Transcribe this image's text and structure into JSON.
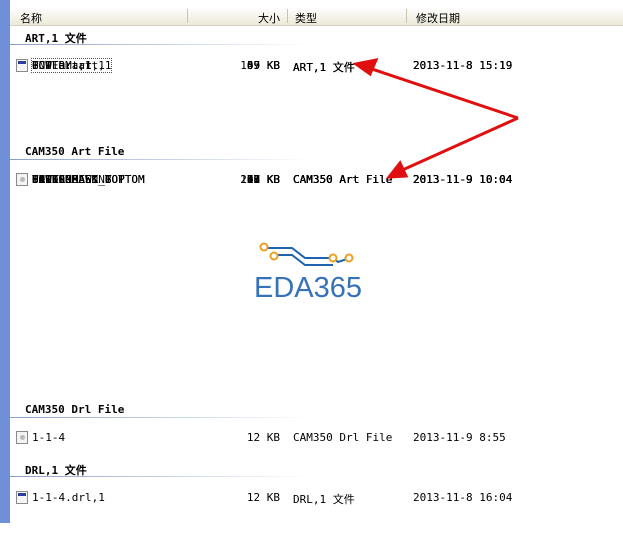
{
  "header": {
    "name": "名称",
    "size": "大小",
    "type": "类型",
    "modified": "修改日期"
  },
  "groups": [
    {
      "title": "ART,1 文件",
      "icon": "app-file-icon",
      "files": [
        {
          "name": "BOTTOM.art,1",
          "size": "67 KB",
          "type": "ART,1 文件",
          "date": "2013-11-8 15:19"
        },
        {
          "name": "GND.art,1",
          "size": "45 KB",
          "type": "ART,1 文件",
          "date": "2013-11-8 15:19"
        },
        {
          "name": "POWER.art,1",
          "size": "59 KB",
          "type": "ART,1 文件",
          "date": "2013-11-8 15:19"
        },
        {
          "name": "TOP.art,1",
          "size": "109 KB",
          "type": "ART,1 文件",
          "date": "2013-11-8 15:19"
        }
      ]
    },
    {
      "title": "CAM350 Art File",
      "icon": "generic-file-icon",
      "files": [
        {
          "name": "BOTTOM",
          "size": "67 KB",
          "type": "CAM350 Art File",
          "date": "2013-11-9 10:04"
        },
        {
          "name": "DRILLDRAWING",
          "size": "96 KB",
          "type": "CAM350 Art File",
          "date": "2013-11-9 10:04"
        },
        {
          "name": "GND",
          "size": "33 KB",
          "type": "CAM350 Art File",
          "date": "2013-11-9 10:04"
        },
        {
          "name": "OUTLINE",
          "size": "1 KB",
          "type": "CAM350 Art File",
          "date": "2013-11-9 10:04"
        },
        {
          "name": "PASTERMASK_BOTTOM",
          "size": "18 KB",
          "type": "CAM350 Art File",
          "date": "2013-11-9 10:04"
        },
        {
          "name": "PASTERMASK_TOP",
          "size": "31 KB",
          "type": "CAM350 Art File",
          "date": "2013-11-9 10:04"
        },
        {
          "name": "POWER",
          "size": "47 KB",
          "type": "CAM350 Art File",
          "date": "2013-11-9 10:04"
        },
        {
          "name": "SILKSCREEN_BOTTOM",
          "size": "77 KB",
          "type": "CAM350 Art File",
          "date": "2013-11-9 10:04"
        },
        {
          "name": "SILKSCREEN_TOP",
          "size": "232 KB",
          "type": "CAM350 Art File",
          "date": "2013-11-9 10:04"
        },
        {
          "name": "SOLDERMASK_BOTTOM",
          "size": "18 KB",
          "type": "CAM350 Art File",
          "date": "2013-11-9 10:04"
        },
        {
          "name": "SOLDERMASK_TOP",
          "size": "37 KB",
          "type": "CAM350 Art File",
          "date": "2013-11-9 10:04"
        },
        {
          "name": "TOP",
          "size": "109 KB",
          "type": "CAM350 Art File",
          "date": "2013-11-9 10:04"
        }
      ]
    },
    {
      "title": "CAM350 Drl File",
      "icon": "generic-file-icon",
      "files": [
        {
          "name": "1-1-4",
          "size": "12 KB",
          "type": "CAM350 Drl File",
          "date": "2013-11-9 8:55"
        }
      ]
    },
    {
      "title": "DRL,1 文件",
      "icon": "app-file-icon",
      "files": [
        {
          "name": "1-1-4.drl,1",
          "size": "12 KB",
          "type": "DRL,1 文件",
          "date": "2013-11-8 16:04"
        }
      ]
    }
  ],
  "watermark": "EDA365",
  "colors": {
    "arrow": "#e01010",
    "watermark": "#1f63b0",
    "trace": "#e8a020"
  }
}
